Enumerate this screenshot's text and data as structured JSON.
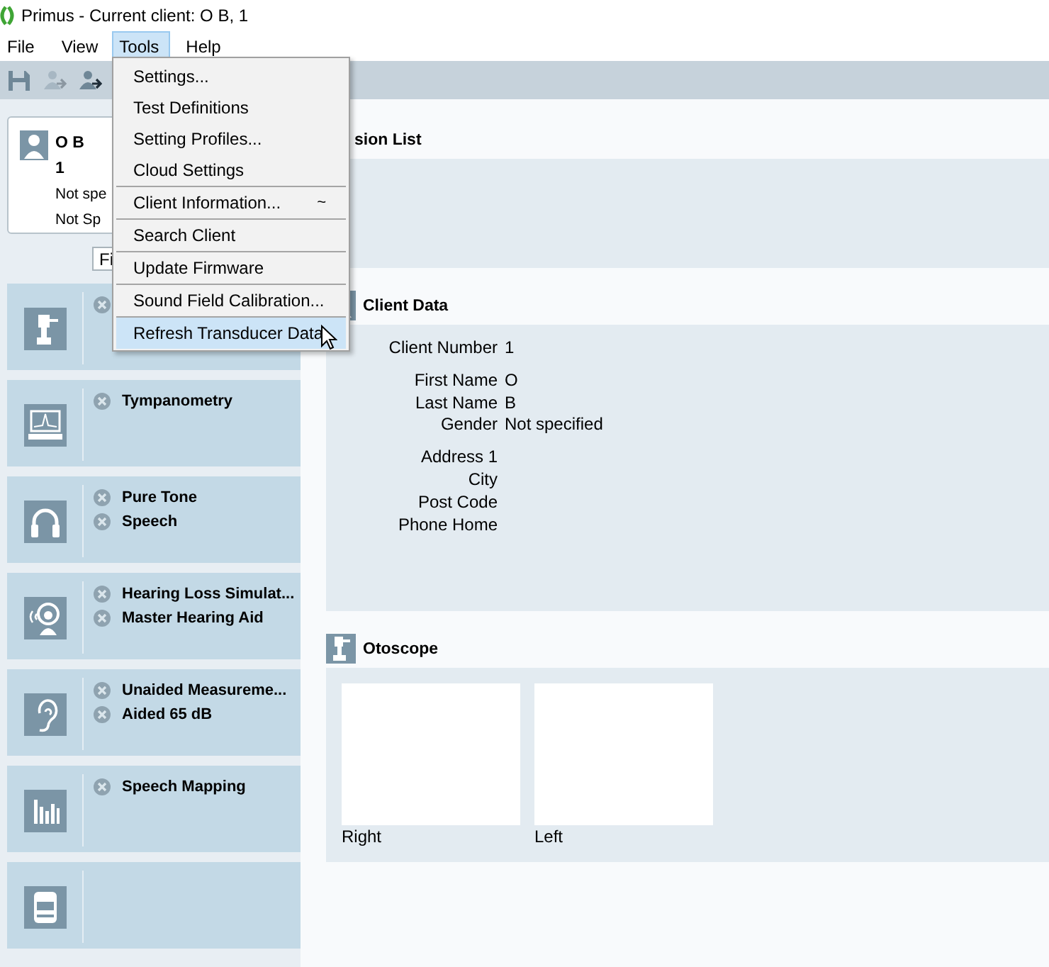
{
  "window": {
    "title": "Primus - Current client: O B, 1"
  },
  "menu_bar": [
    {
      "label": "File",
      "selected": false
    },
    {
      "label": "View",
      "selected": false
    },
    {
      "label": "Tools",
      "selected": true
    },
    {
      "label": "Help",
      "selected": false
    }
  ],
  "toolbar": [
    {
      "kind": "save",
      "disabled": false
    },
    {
      "kind": "person-arrow",
      "disabled": true
    },
    {
      "kind": "person-arrow",
      "disabled": false
    }
  ],
  "client_card": {
    "name": "O B",
    "number": "1",
    "line_3": "Not spe",
    "line_4": "Not Sp"
  },
  "filter_dropdown": {
    "value": "Fi"
  },
  "modules": [
    {
      "kind": "otoscope",
      "items_covered": true
    },
    {
      "kind": "tympanometry",
      "items": [
        {
          "label": "Tympanometry"
        }
      ]
    },
    {
      "kind": "headphones",
      "items": [
        {
          "label": "Pure Tone"
        },
        {
          "label": "Speech"
        }
      ]
    },
    {
      "kind": "listener",
      "items": [
        {
          "label": "Hearing Loss Simulat..."
        },
        {
          "label": "Master Hearing Aid"
        }
      ]
    },
    {
      "kind": "ear",
      "items": [
        {
          "label": "Unaided Measureme..."
        },
        {
          "label": "Aided 65 dB"
        }
      ]
    },
    {
      "kind": "bars",
      "items": [
        {
          "label": "Speech Mapping"
        }
      ]
    },
    {
      "kind": "device"
    }
  ],
  "sections": [
    {
      "kind": "list",
      "title": "sion List"
    },
    {
      "kind": "fields",
      "title": "Client Data",
      "field_groups": [
        [
          {
            "label": "Client Number",
            "value": "1"
          }
        ],
        [
          {
            "label": "First Name",
            "value": "O"
          },
          {
            "label": "Last Name",
            "value": "B"
          },
          {
            "label": "Gender",
            "value": "Not specified"
          }
        ],
        [
          {
            "label": "Address 1"
          },
          {
            "label": "City"
          },
          {
            "label": "Post Code"
          },
          {
            "label": "Phone Home"
          }
        ]
      ]
    },
    {
      "kind": "images",
      "title": "Otoscope",
      "images": [
        {
          "label": "Right"
        },
        {
          "label": "Left"
        }
      ]
    }
  ],
  "tools_menu": {
    "items": [
      {
        "label": "Settings...",
        "separator_before": false,
        "selected": false
      },
      {
        "label": "Test Definitions",
        "separator_before": false,
        "selected": false
      },
      {
        "label": "Setting Profiles...",
        "separator_before": false,
        "selected": false
      },
      {
        "label": "Cloud Settings",
        "separator_before": false,
        "selected": false
      },
      {
        "label": "Client Information...",
        "shortcut": "~",
        "separator_before": true,
        "selected": false
      },
      {
        "label": "Search Client",
        "separator_before": true,
        "selected": false
      },
      {
        "label": "Update Firmware",
        "separator_before": true,
        "selected": false
      },
      {
        "label": "Sound Field Calibration...",
        "separator_before": true,
        "selected": false
      },
      {
        "label": "Refresh Transducer Data",
        "separator_before": true,
        "selected": true
      }
    ]
  }
}
